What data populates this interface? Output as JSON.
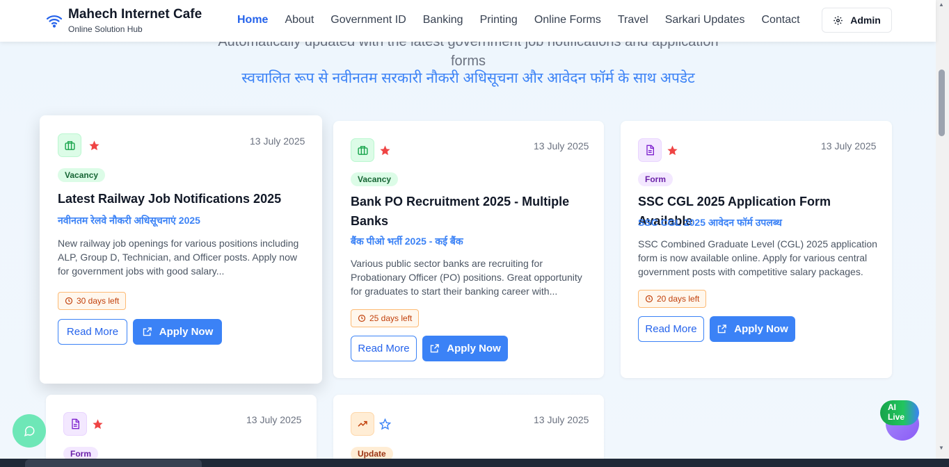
{
  "header": {
    "brand_title": "Mahech Internet Cafe",
    "brand_subtitle": "Online Solution Hub",
    "nav": [
      "Home",
      "About",
      "Government ID",
      "Banking",
      "Printing",
      "Online Forms",
      "Travel",
      "Sarkari Updates",
      "Contact"
    ],
    "admin_label": "Admin"
  },
  "hero": {
    "line1": "Automatically updated with the latest government job notifications and application forms",
    "hindi": "स्वचालित रूप से नवीनतम सरकारी नौकरी अधिसूचना और आवेदन फॉर्म के साथ अपडेट"
  },
  "cards": [
    {
      "icon": "briefcase-icon",
      "starred": true,
      "date": "13 July 2025",
      "tag": "Vacancy",
      "title": "Latest Railway Job Notifications 2025",
      "hindi": "नवीनतम रेलवे नौकरी अधिसूचनाएं 2025",
      "desc": "New railway job openings for various positions including ALP, Group D, Technician, and Officer posts. Apply now for government jobs with good salary...",
      "days_left": "30 days left",
      "read_more": "Read More",
      "apply": "Apply Now"
    },
    {
      "icon": "briefcase-icon",
      "starred": true,
      "date": "13 July 2025",
      "tag": "Vacancy",
      "title": "Bank PO Recruitment 2025 - Multiple Banks",
      "hindi": "बैंक पीओ भर्ती 2025 - कई बैंक",
      "desc": "Various public sector banks are recruiting for Probationary Officer (PO) positions. Great opportunity for graduates to start their banking career with...",
      "days_left": "25 days left",
      "read_more": "Read More",
      "apply": "Apply Now"
    },
    {
      "icon": "document-icon",
      "starred": true,
      "date": "13 July 2025",
      "tag": "Form",
      "title": "SSC CGL 2025 Application Form Available",
      "hindi": "SSC CGL 2025 आवेदन फॉर्म उपलब्ध",
      "desc": "SSC Combined Graduate Level (CGL) 2025 application form is now available online. Apply for various central government posts with competitive salary packages.",
      "days_left": "20 days left",
      "read_more": "Read More",
      "apply": "Apply Now"
    },
    {
      "icon": "document-icon",
      "starred": true,
      "date": "13 July 2025",
      "tag": "Form"
    },
    {
      "icon": "trending-up-icon",
      "starred": false,
      "date": "13 July 2025",
      "tag": "Update"
    }
  ],
  "floating": {
    "ai_label_1": "AI",
    "ai_label_2": "Live"
  },
  "colors": {
    "accent": "#3b82f6",
    "star": "#ef4444",
    "vacancy": "#dcfce7",
    "form": "#f3e8ff",
    "update": "#ffedd5"
  }
}
